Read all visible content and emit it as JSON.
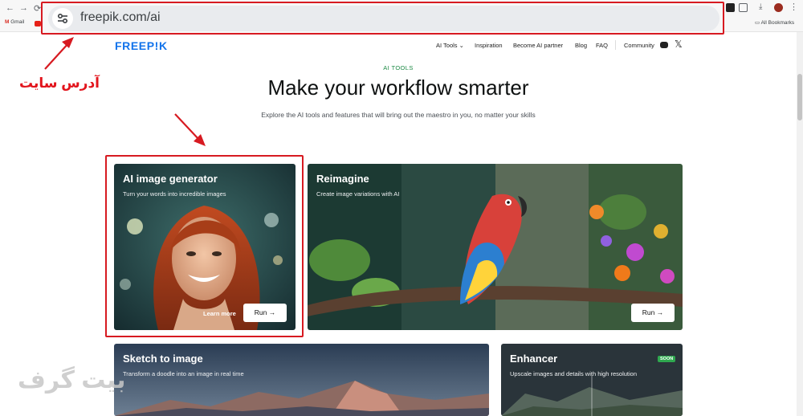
{
  "browser": {
    "url": "freepik.com/ai",
    "bookmarks": [
      "Gmail",
      "All Bookmarks"
    ]
  },
  "site": {
    "logo": "FREEP!K",
    "nav": [
      {
        "label": "AI Tools",
        "has_dropdown": true
      },
      {
        "label": "Inspiration"
      },
      {
        "label": "Become AI partner"
      },
      {
        "label": "Blog"
      },
      {
        "label": "FAQ"
      },
      {
        "label": "Community"
      }
    ]
  },
  "hero": {
    "eyebrow": "AI TOOLS",
    "title": "Make your workflow smarter",
    "subtitle": "Explore the AI tools and features that will bring out the maestro in you, no matter your skills"
  },
  "cards": [
    {
      "title": "AI image generator",
      "desc": "Turn your words into incredible images",
      "learn_more": "Learn more",
      "run": "Run"
    },
    {
      "title": "Reimagine",
      "desc": "Create image variations with AI",
      "run": "Run"
    },
    {
      "title": "Sketch to image",
      "desc": "Transform a doodle into an image in real time"
    },
    {
      "title": "Enhancer",
      "desc": "Upscale images and details with high resolution",
      "badge": "SOON"
    }
  ],
  "annotations": {
    "address_label": "آدرس سایت",
    "watermark": "بیت گرف"
  },
  "colors": {
    "annotation_red": "#d71a21",
    "brand_blue": "#1273eb",
    "accent_green": "#1d8a45"
  }
}
